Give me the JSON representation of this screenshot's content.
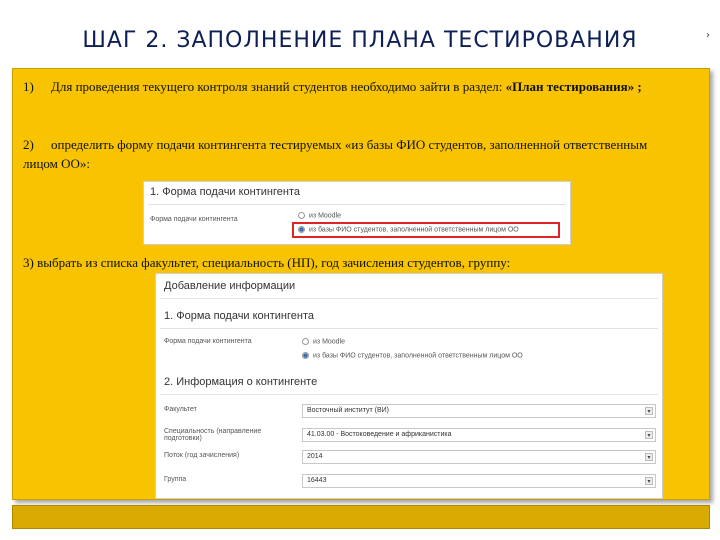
{
  "title": "ШАГ 2. ЗАПОЛНЕНИЕ ПЛАНА ТЕСТИРОВАНИЯ",
  "items": [
    {
      "num": "1)",
      "text": "Для проведения текущего контроля знаний студентов необходимо зайти в раздел: ",
      "bold": "«План тестирования» ;"
    },
    {
      "num": "2)",
      "text": "определить форму подачи контингента тестируемых «из базы ФИО студентов, заполненной ответственным лицом ОО»:"
    },
    {
      "num": "3)",
      "text": "выбрать из списка факультет, специальность (НП), год зачисления студентов, группу:"
    }
  ],
  "shot1": {
    "heading": "1. Форма подачи контингента",
    "label": "Форма подачи контингента",
    "option1": "из Moodle",
    "option2": "из базы ФИО студентов, заполненной ответственным лицом ОО"
  },
  "shot2": {
    "heading": "Добавление информации",
    "section1": "1. Форма подачи контингента",
    "label": "Форма подачи контингента",
    "option1": "из Moodle",
    "option2": "из базы ФИО студентов, заполненной ответственным лицом ОО",
    "section2": "2. Информация о контингенте",
    "fields": [
      {
        "label": "Факультет",
        "value": "Восточный институт (ВИ)"
      },
      {
        "label": "Специальность (направление подготовки)",
        "value": "41.03.00 - Востоковедение и африканистика"
      },
      {
        "label": "Поток (год зачисления)",
        "value": "2014"
      },
      {
        "label": "Группа",
        "value": "16443"
      }
    ]
  }
}
